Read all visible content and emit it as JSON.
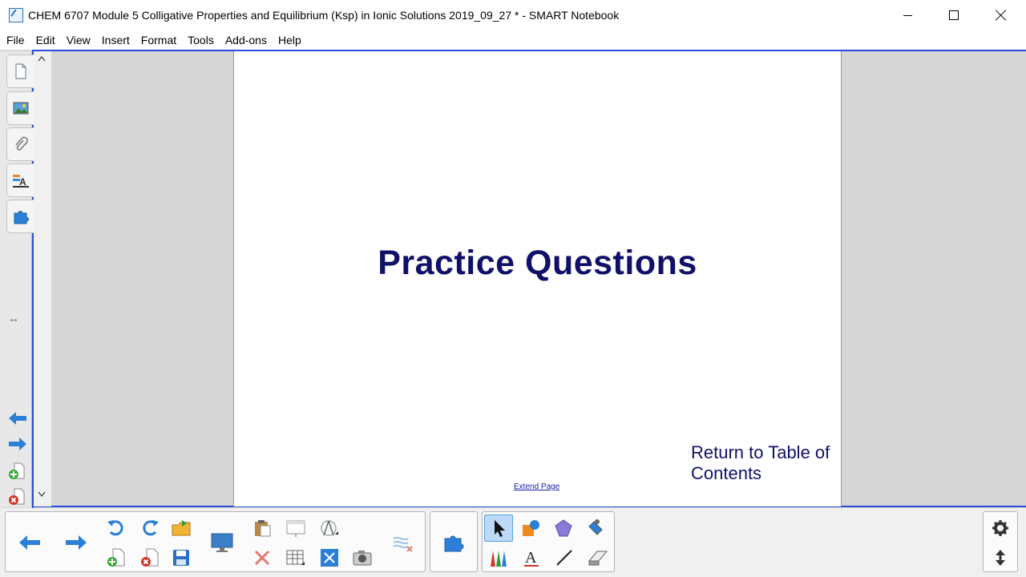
{
  "window": {
    "title": "CHEM 6707 Module 5 Colligative Properties and Equilibrium (Ksp) in Ionic Solutions 2019_09_27 * - SMART Notebook"
  },
  "menu": {
    "items": [
      {
        "name": "menu-file",
        "label": "File"
      },
      {
        "name": "menu-edit",
        "label": "Edit"
      },
      {
        "name": "menu-view",
        "label": "View"
      },
      {
        "name": "menu-insert",
        "label": "Insert"
      },
      {
        "name": "menu-format",
        "label": "Format"
      },
      {
        "name": "menu-tools",
        "label": "Tools"
      },
      {
        "name": "menu-addons",
        "label": "Add-ons"
      },
      {
        "name": "menu-help",
        "label": "Help"
      }
    ]
  },
  "sidebar": {
    "tabs": [
      {
        "name": "page-sorter-tab",
        "icon": "page-sorter-icon"
      },
      {
        "name": "gallery-tab",
        "icon": "gallery-icon"
      },
      {
        "name": "attachments-tab",
        "icon": "paperclip-icon"
      },
      {
        "name": "properties-tab",
        "icon": "properties-icon"
      },
      {
        "name": "addons-tab",
        "icon": "puzzle-icon"
      }
    ],
    "dock_glyph": "↔"
  },
  "page": {
    "title": "Practice Questions",
    "return_link": "Return to Table of Contents",
    "extend_page": "Extend Page"
  },
  "toolbar": {
    "buttons": [
      "previous-page-button",
      "next-page-button",
      "undo-button",
      "redo-button",
      "add-page-button",
      "delete-page-button",
      "open-file-button",
      "save-button",
      "screen-display-button",
      "paste-button",
      "delete-button",
      "screen-shade-button",
      "insert-table-button",
      "measurement-tools-button",
      "full-screen-button",
      "capture-button",
      "magic-pen-button",
      "addons-button",
      "select-button",
      "shapes-button",
      "fill-button",
      "properties-button",
      "pens-button",
      "text-button",
      "lines-button",
      "eraser-button",
      "settings-button",
      "move-toolbar-button"
    ],
    "selected_tool": "select-button"
  },
  "colors": {
    "title_text": "#10106a",
    "page_frame": "#2a4dd8",
    "nav_arrow": "#2b7fd6",
    "selected_tool_bg": "#bcd9f7"
  }
}
